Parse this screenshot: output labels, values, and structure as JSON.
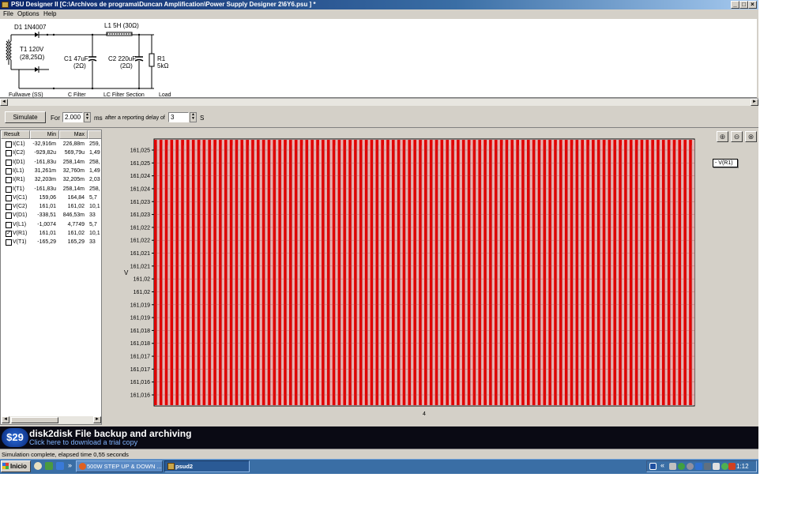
{
  "window": {
    "title": "PSU Designer II  [C:\\Archivos de programa\\Duncan Amplification\\Power Supply Designer 2\\6Y6.psu ] *",
    "controls": [
      "_",
      "□",
      "×"
    ]
  },
  "menu": [
    "File",
    "Options",
    "Help"
  ],
  "schematic": {
    "labels": {
      "d1": "D1 1N4007",
      "l1": "L1 5H (30Ω)",
      "t1_a": "T1 120V",
      "t1_b": "(28,25Ω)",
      "c1_a": "C1 47uF",
      "c1_b": "(2Ω)",
      "c2_a": "C2 220uF",
      "c2_b": "(2Ω)",
      "r1_a": "R1",
      "r1_b": "5kΩ"
    },
    "sections": [
      "Fullwave (SS)",
      "C Filter",
      "LC Filter Section",
      "Load"
    ]
  },
  "simbar": {
    "simulate_label": "Simulate",
    "for_label": "For",
    "duration": "2.000",
    "ms_label": "ms",
    "delay_label": "after a reporting delay of",
    "delay": "3",
    "s_label": "S"
  },
  "results": {
    "headers": [
      "Result",
      "Min",
      "Max"
    ],
    "rows": [
      {
        "name": "I(C1)",
        "min": "-32,916m",
        "max": "226,88m",
        "extra": "259,",
        "checked": false
      },
      {
        "name": "I(C2)",
        "min": "-929,82u",
        "max": "569,79u",
        "extra": "1,49",
        "checked": false
      },
      {
        "name": "I(D1)",
        "min": "-161,83u",
        "max": "258,14m",
        "extra": "258,",
        "checked": false
      },
      {
        "name": "I(L1)",
        "min": "31,261m",
        "max": "32,760m",
        "extra": "1,49",
        "checked": false
      },
      {
        "name": "I(R1)",
        "min": "32,203m",
        "max": "32,205m",
        "extra": "2,03",
        "checked": false
      },
      {
        "name": "I(T1)",
        "min": "-161,83u",
        "max": "258,14m",
        "extra": "258,",
        "checked": false
      },
      {
        "name": "V(C1)",
        "min": "159,06",
        "max": "164,84",
        "extra": "5,7",
        "checked": false
      },
      {
        "name": "V(C2)",
        "min": "161,01",
        "max": "161,02",
        "extra": "10,1",
        "checked": false
      },
      {
        "name": "V(D1)",
        "min": "-338,51",
        "max": "846,53m",
        "extra": "33",
        "checked": false
      },
      {
        "name": "V(L1)",
        "min": "-1,0074",
        "max": "4,7749",
        "extra": "5,7",
        "checked": false
      },
      {
        "name": "V(R1)",
        "min": "161,01",
        "max": "161,02",
        "extra": "10,1",
        "checked": true
      },
      {
        "name": "V(T1)",
        "min": "-165,29",
        "max": "165,29",
        "extra": "33",
        "checked": false
      }
    ]
  },
  "chart_data": {
    "type": "line",
    "yticks": [
      "161,025",
      "161,025",
      "161,024",
      "161,024",
      "161,023",
      "161,023",
      "161,022",
      "161,022",
      "161,021",
      "161,021",
      "161,02",
      "161,02",
      "161,019",
      "161,019",
      "161,018",
      "161,018",
      "161,017",
      "161,017",
      "161,016",
      "161,016"
    ],
    "ylabel": "V",
    "xtick": "4",
    "series": [
      {
        "name": "V(R1)",
        "color": "#e00000"
      }
    ],
    "ylim": [
      161.016,
      161.025
    ],
    "cycles": 100,
    "grid": true,
    "legend": "right"
  },
  "zoom_icons": [
    "zoom-in-icon",
    "zoom-out-icon",
    "zoom-reset-icon"
  ],
  "ad": {
    "price": "$29",
    "title": "disk2disk File backup and archiving",
    "subtitle": "Click here to download a trial copy"
  },
  "status": "Simulation complete, elapsed time 0,55 seconds",
  "taskbar": {
    "start": "Inicio",
    "more": "»",
    "tasks": [
      "500W STEP UP & DOWN ...",
      "psud2"
    ],
    "tray_arrow": "«",
    "clock": "1:12"
  }
}
